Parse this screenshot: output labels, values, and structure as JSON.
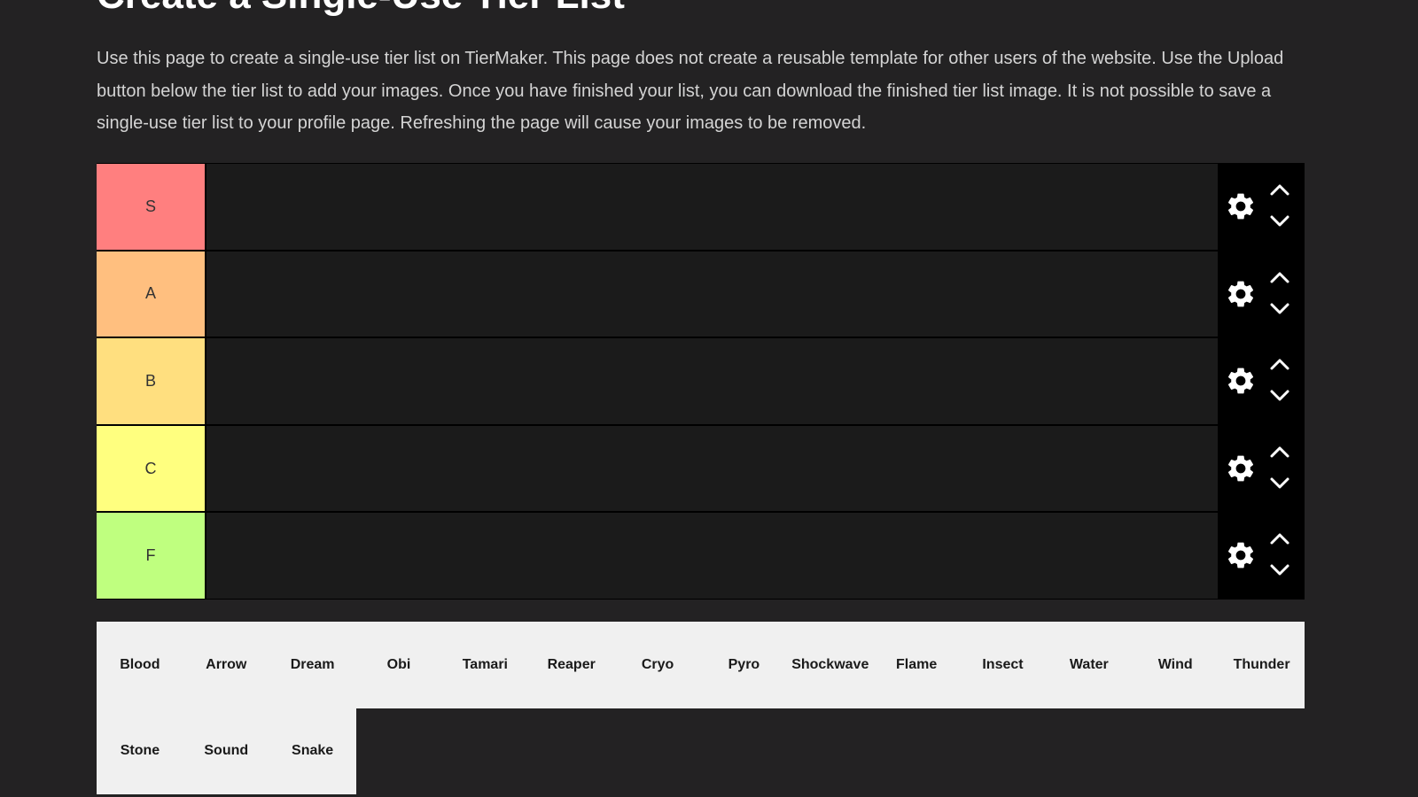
{
  "page": {
    "title": "Create a Single-Use Tier List",
    "description": "Use this page to create a single-use tier list on TierMaker. This page does not create a reusable template for other users of the website. Use the Upload button below the tier list to add your images. Once you have finished your list, you can download the finished tier list image. It is not possible to save a single-use tier list to your profile page. Refreshing the page will cause your images to be removed."
  },
  "tiers": [
    {
      "label": "S",
      "color": "#ff7f7f"
    },
    {
      "label": "A",
      "color": "#ffbf7f"
    },
    {
      "label": "B",
      "color": "#ffdf7f"
    },
    {
      "label": "C",
      "color": "#ffff7f"
    },
    {
      "label": "F",
      "color": "#bfff7f"
    }
  ],
  "icons": {
    "settings": "gear-icon",
    "move_up": "chevron-up-icon",
    "move_down": "chevron-down-icon"
  },
  "pool_items": [
    "Blood",
    "Arrow",
    "Dream",
    "Obi",
    "Tamari",
    "Reaper",
    "Cryo",
    "Pyro",
    "Shockwave",
    "Flame",
    "Insect",
    "Water",
    "Wind",
    "Thunder",
    "Stone",
    "Sound",
    "Snake"
  ]
}
